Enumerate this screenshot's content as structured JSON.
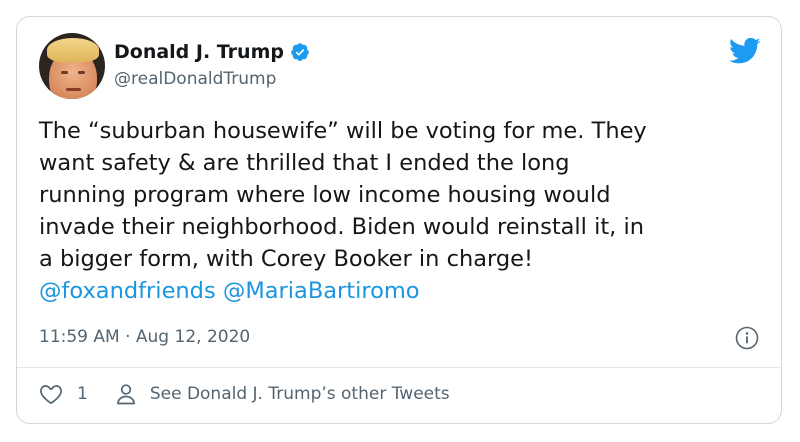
{
  "author": {
    "name": "Donald J. Trump",
    "handle": "@realDonaldTrump"
  },
  "tweet": {
    "lines": [
      "The “suburban housewife” will be voting for me. They",
      "want safety & are thrilled that I ended the long",
      "running program where low income housing would",
      "invade their neighborhood. Biden would reinstall it, in",
      "a bigger form, with Corey Booker in charge!"
    ],
    "mentions": [
      "@foxandfriends",
      "@MariaBartiromo"
    ]
  },
  "timestamp": "11:59 AM · Aug 12, 2020",
  "actions": {
    "like_count": "1",
    "other_tweets_label": "See Donald J. Trump’s other Tweets"
  },
  "colors": {
    "link": "#1b95e0",
    "verified": "#1d9bf0",
    "secondary_text": "#536471"
  },
  "icons": [
    "verified-badge-icon",
    "twitter-bird-icon",
    "info-icon",
    "heart-icon",
    "person-icon"
  ]
}
